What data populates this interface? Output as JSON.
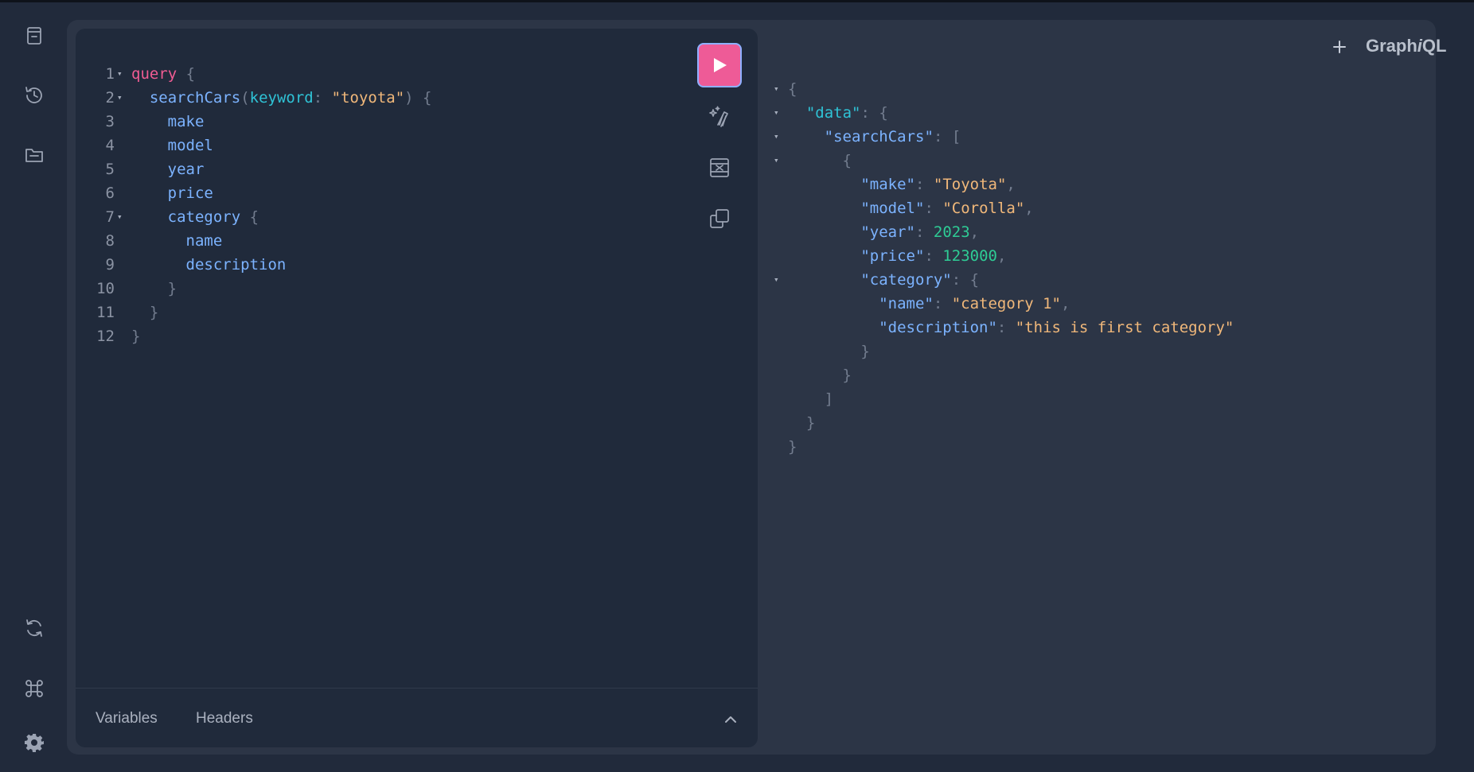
{
  "app": {
    "logo_prefix": "Graph",
    "logo_italic": "i",
    "logo_suffix": "QL"
  },
  "sidebar": {
    "top_icons": [
      "docs-icon",
      "history-icon",
      "explorer-folder-icon"
    ],
    "bottom_icons": [
      "refetch-schema-icon",
      "shortcuts-icon",
      "settings-icon"
    ]
  },
  "toolbar": {
    "icons": [
      "execute-play-icon",
      "prettify-icon",
      "merge-fragments-icon",
      "copy-query-icon"
    ]
  },
  "editor": {
    "lines": [
      {
        "num": "1",
        "fold": true,
        "indent": 0,
        "tokens": [
          {
            "t": "query",
            "c": "kw"
          },
          {
            "t": " {",
            "c": "punc"
          }
        ]
      },
      {
        "num": "2",
        "fold": true,
        "indent": 1,
        "tokens": [
          {
            "t": "searchCars",
            "c": "field"
          },
          {
            "t": "(",
            "c": "punc"
          },
          {
            "t": "keyword",
            "c": "arg"
          },
          {
            "t": ": ",
            "c": "punc"
          },
          {
            "t": "\"toyota\"",
            "c": "str"
          },
          {
            "t": ") {",
            "c": "punc"
          }
        ]
      },
      {
        "num": "3",
        "fold": false,
        "indent": 2,
        "tokens": [
          {
            "t": "make",
            "c": "field"
          }
        ]
      },
      {
        "num": "4",
        "fold": false,
        "indent": 2,
        "tokens": [
          {
            "t": "model",
            "c": "field"
          }
        ]
      },
      {
        "num": "5",
        "fold": false,
        "indent": 2,
        "tokens": [
          {
            "t": "year",
            "c": "field"
          }
        ]
      },
      {
        "num": "6",
        "fold": false,
        "indent": 2,
        "tokens": [
          {
            "t": "price",
            "c": "field"
          }
        ]
      },
      {
        "num": "7",
        "fold": true,
        "indent": 2,
        "tokens": [
          {
            "t": "category",
            "c": "field"
          },
          {
            "t": " {",
            "c": "punc"
          }
        ]
      },
      {
        "num": "8",
        "fold": false,
        "indent": 3,
        "tokens": [
          {
            "t": "name",
            "c": "field"
          }
        ]
      },
      {
        "num": "9",
        "fold": false,
        "indent": 3,
        "tokens": [
          {
            "t": "description",
            "c": "field"
          }
        ]
      },
      {
        "num": "10",
        "fold": false,
        "indent": 2,
        "tokens": [
          {
            "t": "}",
            "c": "punc"
          }
        ]
      },
      {
        "num": "11",
        "fold": false,
        "indent": 1,
        "tokens": [
          {
            "t": "}",
            "c": "punc"
          }
        ]
      },
      {
        "num": "12",
        "fold": false,
        "indent": 0,
        "tokens": [
          {
            "t": "}",
            "c": "punc"
          }
        ]
      }
    ]
  },
  "bottom_tabs": {
    "variables": "Variables",
    "headers": "Headers"
  },
  "result": {
    "lines": [
      {
        "fold": true,
        "indent": 0,
        "tokens": [
          {
            "t": "{",
            "c": "punc"
          }
        ]
      },
      {
        "fold": true,
        "indent": 1,
        "tokens": [
          {
            "t": "\"data\"",
            "c": "arg"
          },
          {
            "t": ": {",
            "c": "punc"
          }
        ]
      },
      {
        "fold": true,
        "indent": 2,
        "tokens": [
          {
            "t": "\"searchCars\"",
            "c": "key"
          },
          {
            "t": ": [",
            "c": "punc"
          }
        ]
      },
      {
        "fold": true,
        "indent": 3,
        "tokens": [
          {
            "t": "{",
            "c": "punc"
          }
        ]
      },
      {
        "fold": false,
        "indent": 4,
        "tokens": [
          {
            "t": "\"make\"",
            "c": "key"
          },
          {
            "t": ": ",
            "c": "punc"
          },
          {
            "t": "\"Toyota\"",
            "c": "str"
          },
          {
            "t": ",",
            "c": "punc"
          }
        ]
      },
      {
        "fold": false,
        "indent": 4,
        "tokens": [
          {
            "t": "\"model\"",
            "c": "key"
          },
          {
            "t": ": ",
            "c": "punc"
          },
          {
            "t": "\"Corolla\"",
            "c": "str"
          },
          {
            "t": ",",
            "c": "punc"
          }
        ]
      },
      {
        "fold": false,
        "indent": 4,
        "tokens": [
          {
            "t": "\"year\"",
            "c": "key"
          },
          {
            "t": ": ",
            "c": "punc"
          },
          {
            "t": "2023",
            "c": "num"
          },
          {
            "t": ",",
            "c": "punc"
          }
        ]
      },
      {
        "fold": false,
        "indent": 4,
        "tokens": [
          {
            "t": "\"price\"",
            "c": "key"
          },
          {
            "t": ": ",
            "c": "punc"
          },
          {
            "t": "123000",
            "c": "num"
          },
          {
            "t": ",",
            "c": "punc"
          }
        ]
      },
      {
        "fold": true,
        "indent": 4,
        "tokens": [
          {
            "t": "\"category\"",
            "c": "key"
          },
          {
            "t": ": {",
            "c": "punc"
          }
        ]
      },
      {
        "fold": false,
        "indent": 5,
        "tokens": [
          {
            "t": "\"name\"",
            "c": "key"
          },
          {
            "t": ": ",
            "c": "punc"
          },
          {
            "t": "\"category 1\"",
            "c": "str"
          },
          {
            "t": ",",
            "c": "punc"
          }
        ]
      },
      {
        "fold": false,
        "indent": 5,
        "tokens": [
          {
            "t": "\"description\"",
            "c": "key"
          },
          {
            "t": ": ",
            "c": "punc"
          },
          {
            "t": "\"this is first category\"",
            "c": "str"
          }
        ]
      },
      {
        "fold": false,
        "indent": 4,
        "tokens": [
          {
            "t": "}",
            "c": "punc"
          }
        ]
      },
      {
        "fold": false,
        "indent": 3,
        "tokens": [
          {
            "t": "}",
            "c": "punc"
          }
        ]
      },
      {
        "fold": false,
        "indent": 2,
        "tokens": [
          {
            "t": "]",
            "c": "punc"
          }
        ]
      },
      {
        "fold": false,
        "indent": 1,
        "tokens": [
          {
            "t": "}",
            "c": "punc"
          }
        ]
      },
      {
        "fold": false,
        "indent": 0,
        "tokens": [
          {
            "t": "}",
            "c": "punc"
          }
        ]
      }
    ]
  },
  "colors": {
    "background": "#212a3b",
    "panel": "#2c3546",
    "editor": "#202a3b",
    "keyword": "#f05c93",
    "field": "#7cb3ff",
    "argument": "#2fc3d6",
    "string": "#f1b87a",
    "number": "#2ecc95",
    "run_button": "#ee5b97"
  }
}
